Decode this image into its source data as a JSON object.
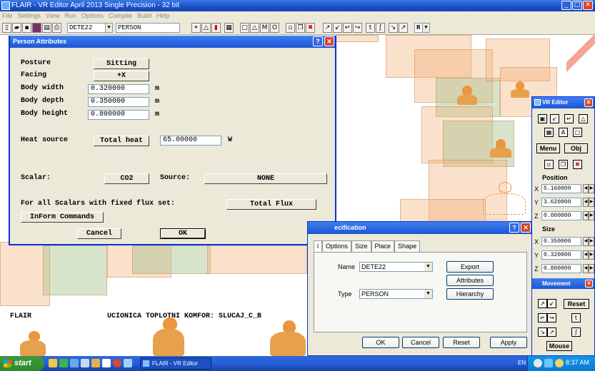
{
  "window": {
    "title": "FLAIR - VR Editor April 2013 Single Precision - 32 bit"
  },
  "menu": [
    "File",
    "Settings",
    "View",
    "Run",
    "Options",
    "Compile",
    "Build",
    "Help"
  ],
  "toolbar": {
    "object_field": "DETE22",
    "type_field": "PERSON",
    "r_label": "R"
  },
  "scene": {
    "label_left": "FLAIR",
    "label_center": "UCIONICA TOPLOTNI KOMFOR: SLUCAJ_C_B"
  },
  "person_dialog": {
    "title": "Person Attributes",
    "posture_label": "Posture",
    "posture_value": "Sitting",
    "facing_label": "Facing",
    "facing_value": "+X",
    "body_width_label": "Body width",
    "body_width_value": "0.320000",
    "body_width_unit": "m",
    "body_depth_label": "Body depth",
    "body_depth_value": "0.350000",
    "body_depth_unit": "m",
    "body_height_label": "Body height",
    "body_height_value": "0.800000",
    "body_height_unit": "m",
    "heat_source_label": "Heat source",
    "heat_source_button": "Total heat",
    "heat_source_value": "65.00000",
    "heat_source_unit": "W",
    "scalar_label": "Scalar:",
    "scalar_button": "CO2",
    "source_label": "Source:",
    "source_button": "NONE",
    "fixed_flux_label": "For all Scalars with fixed flux set:",
    "fixed_flux_button": "Total Flux",
    "inform_button": "InForm Commands",
    "cancel_label": "Cancel",
    "ok_label": "OK"
  },
  "vr_editor": {
    "title": "VR Editor",
    "menu_button": "Menu",
    "obj_button": "Obj",
    "position_label": "Position",
    "pos_x": "5.160000",
    "pos_y": "3.620000",
    "pos_z": "0.000000",
    "size_label": "Size",
    "size_x": "0.350000",
    "size_y": "0.320000",
    "size_z": "0.800000",
    "axis_x": "X",
    "axis_y": "Y",
    "axis_z": "Z",
    "movement_title": "Movement",
    "reset_button": "Reset",
    "mouse_button": "Mouse"
  },
  "object_spec": {
    "title": "ecification",
    "tabs": [
      "l",
      "Options",
      "Size",
      "Place",
      "Shape"
    ],
    "name_label": "Name",
    "name_value": "DETE22",
    "type_label": "Type",
    "type_value": "PERSON",
    "export_button": "Export",
    "attributes_button": "Attributes",
    "hierarchy_button": "Hierarchy",
    "ok_button": "OK",
    "cancel_button": "Cancel",
    "reset_button": "Reset",
    "apply_button": "Apply"
  },
  "taskbar": {
    "start_label": "start",
    "task_label": "FLAIR - VR Editor Apr...",
    "language": "EN",
    "clock": "8:37 AM"
  }
}
